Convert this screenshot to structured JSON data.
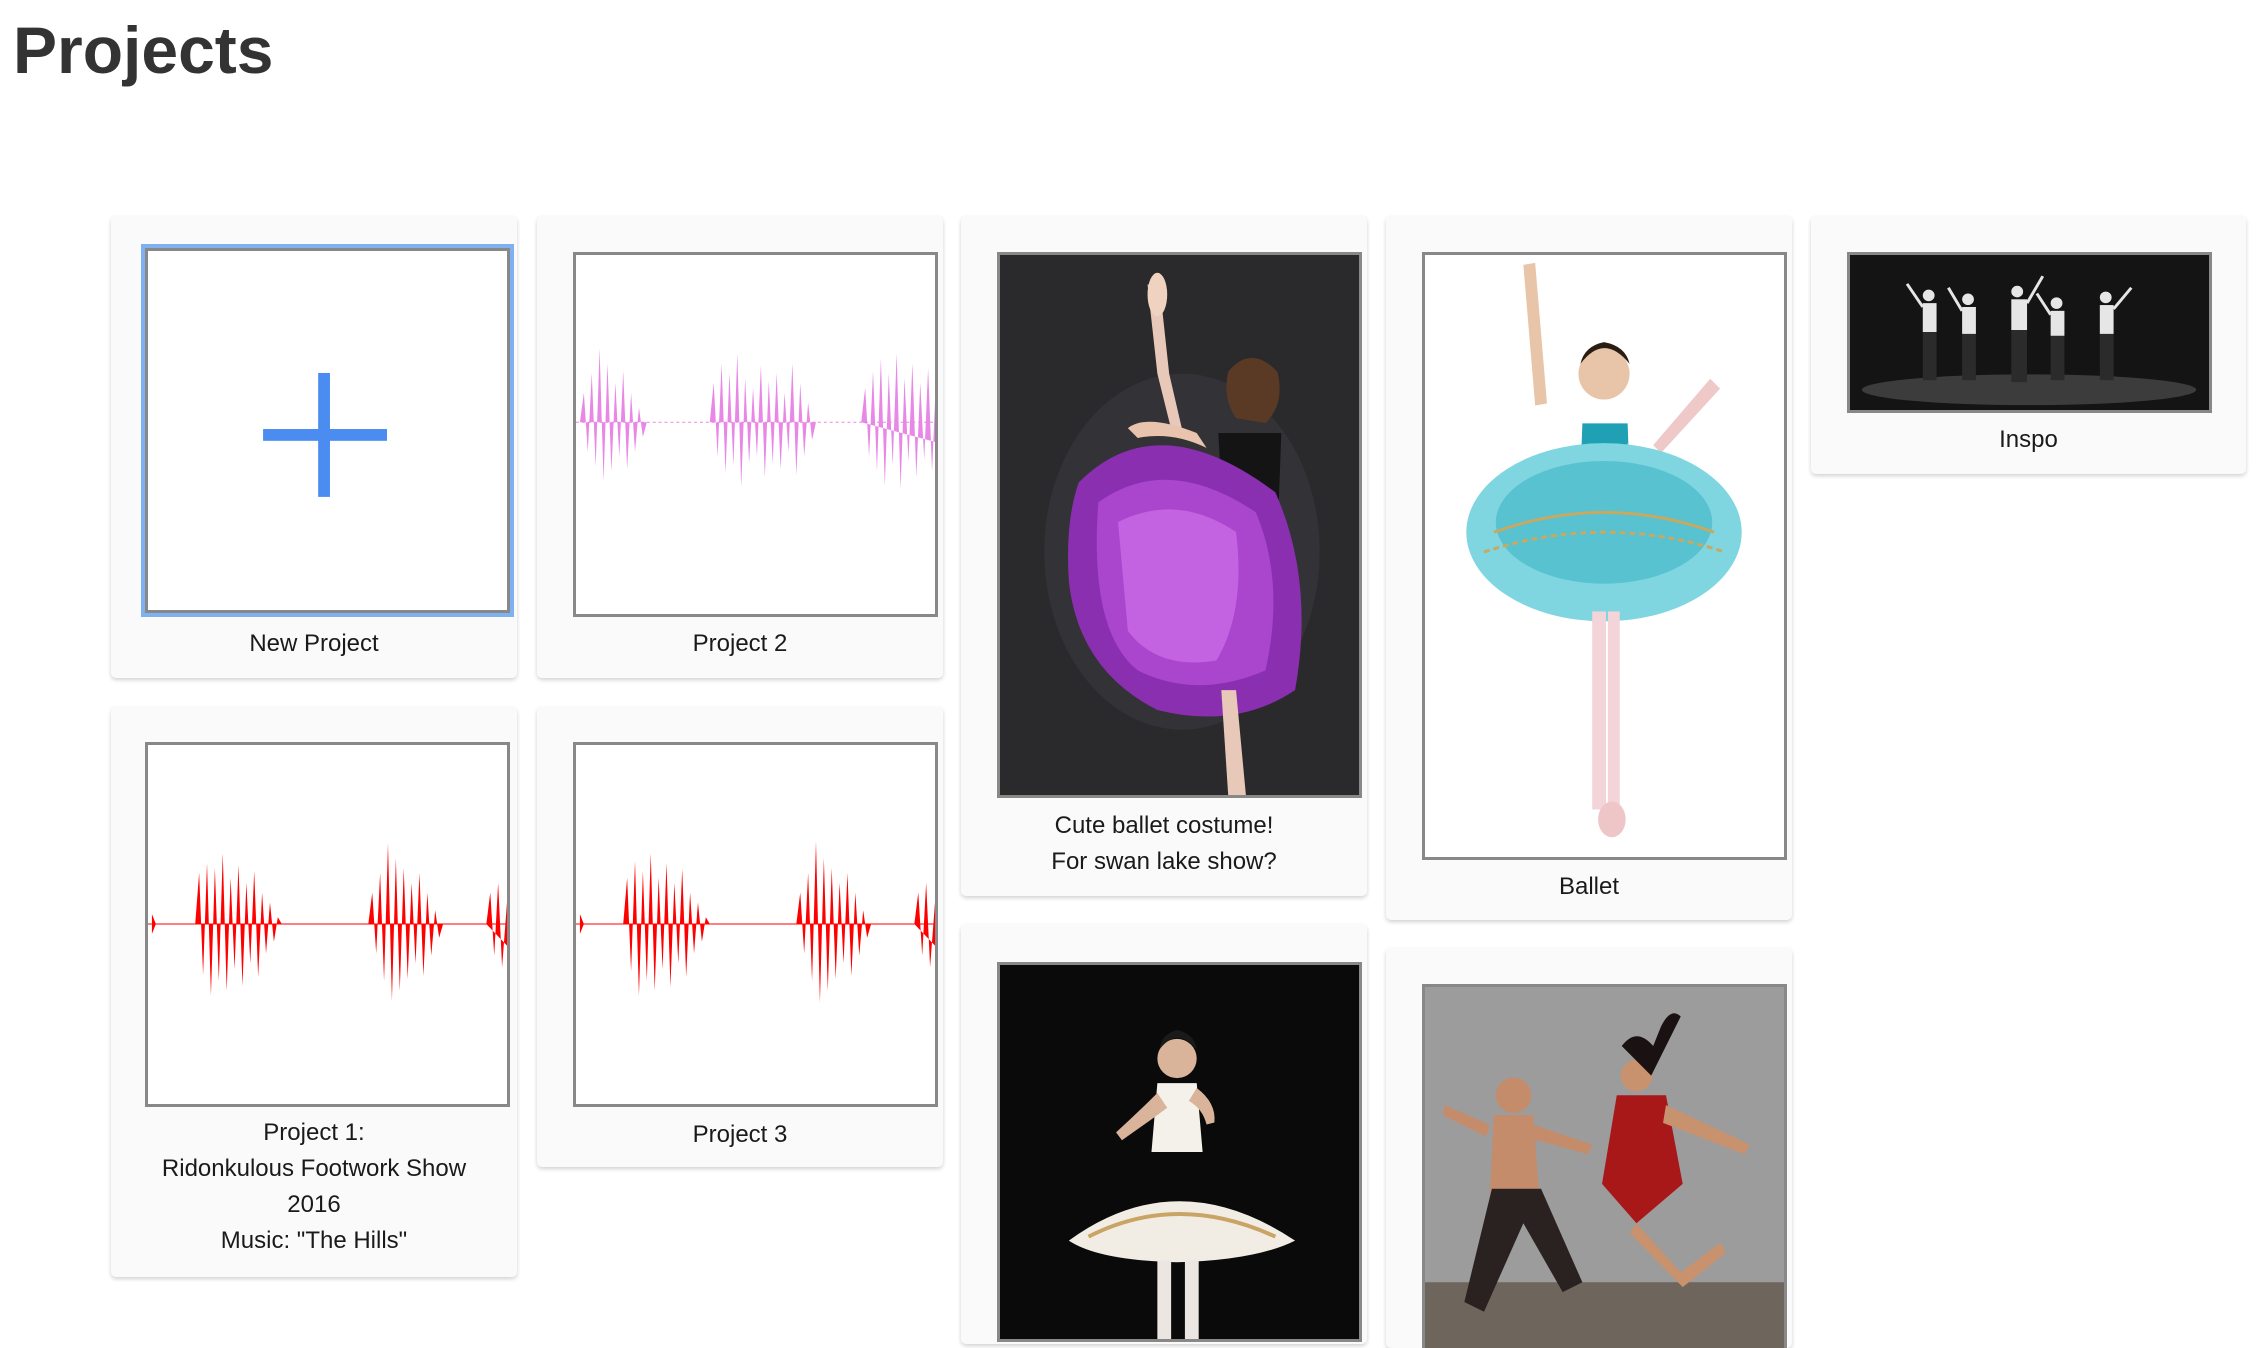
{
  "page": {
    "title": "Projects"
  },
  "colors": {
    "plus_blue": "#4a8cf0",
    "wave_pink": "#e887e6",
    "wave_red": "#ff0000",
    "selected_outline": "#7fb0f0"
  },
  "cards": {
    "new_project": {
      "caption": [
        "New Project"
      ],
      "icon": "plus-icon"
    },
    "project_2": {
      "caption": [
        "Project 2"
      ],
      "thumbnail": "pink-waveform"
    },
    "project_1": {
      "caption": [
        "Project 1:",
        "Ridonkulous Footwork Show",
        "2016",
        "Music: \"The Hills\""
      ],
      "thumbnail": "red-waveform"
    },
    "project_3": {
      "caption": [
        "Project 3"
      ],
      "thumbnail": "red-waveform"
    },
    "costume": {
      "caption": [
        "Cute ballet costume!",
        "For swan lake show?"
      ],
      "thumbnail": "ballerina-purple-tutu-photo"
    },
    "ballet": {
      "caption": [
        "Ballet"
      ],
      "thumbnail": "ballerina-turquoise-tutu-photo"
    },
    "inspo": {
      "caption": [
        "Inspo"
      ],
      "thumbnail": "dance-group-stage-photo"
    },
    "white_tutu": {
      "caption": [],
      "thumbnail": "ballerina-white-tutu-photo"
    },
    "red_dress": {
      "caption": [],
      "thumbnail": "dance-duo-photo"
    }
  }
}
